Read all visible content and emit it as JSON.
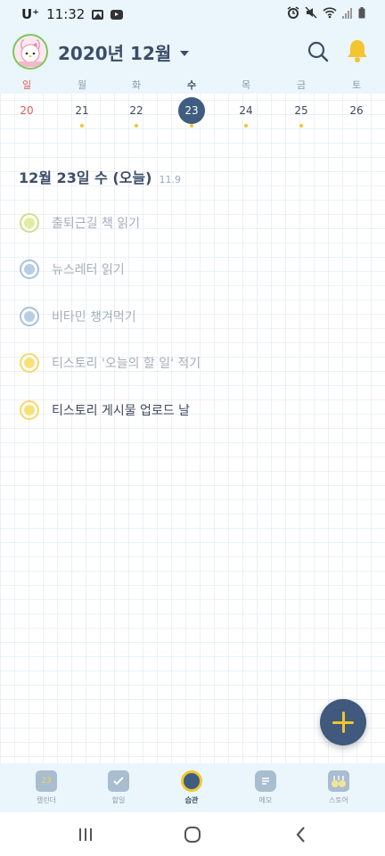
{
  "status_bar": {
    "carrier": "U⁺",
    "time": "11:32"
  },
  "header": {
    "month_label": "2020년 12월"
  },
  "weekdays": [
    "일",
    "월",
    "화",
    "수",
    "목",
    "금",
    "토"
  ],
  "week_dates": [
    {
      "day": "20",
      "has_event": false,
      "is_today": false
    },
    {
      "day": "21",
      "has_event": true,
      "is_today": false
    },
    {
      "day": "22",
      "has_event": true,
      "is_today": false
    },
    {
      "day": "23",
      "has_event": true,
      "is_today": true
    },
    {
      "day": "24",
      "has_event": true,
      "is_today": false
    },
    {
      "day": "25",
      "has_event": true,
      "is_today": false
    },
    {
      "day": "26",
      "has_event": false,
      "is_today": false
    }
  ],
  "selected_day": {
    "title": "12월 23일 수 (오늘)",
    "lunar_date": "11.9"
  },
  "tasks": [
    {
      "text": "출퇴근길 책 읽기",
      "color": "#cfe08a"
    },
    {
      "text": "뉴스레터 읽기",
      "color": "#a9c1dd"
    },
    {
      "text": "비타민 챙겨먹기",
      "color": "#a9c1dd"
    },
    {
      "text": "티스토리 '오늘의 할 일' 적기",
      "color": "#f6d86a"
    },
    {
      "text": "티스토리 게시물 업로드 날",
      "color": "#f6d86a"
    }
  ],
  "bottom_nav": {
    "calendar": "캘린더",
    "todo": "할일",
    "habit": "습관",
    "memo": "메모",
    "store": "스토어",
    "calendar_icon_day": "23"
  },
  "colors": {
    "header_bg": "#eaf6fb",
    "accent_navy": "#3f5d80",
    "accent_yellow": "#f3c52f",
    "sunday_red": "#e15c5c"
  }
}
